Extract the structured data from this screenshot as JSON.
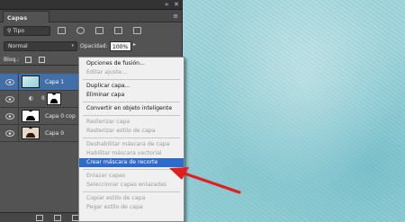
{
  "panel": {
    "tab_label": "Capas",
    "collapse_glyph": "«",
    "close_glyph": "✕",
    "menu_glyph": "≡",
    "filter_kind": "Tipo",
    "blend_mode": "Normal",
    "opacity_label": "Opacidad:",
    "opacity_value": "100%",
    "lock_label": "Bloq.:"
  },
  "layers": [
    {
      "name": "Capa 1",
      "selected": true
    },
    {
      "name": "",
      "selected": false
    },
    {
      "name": "Capa 0 cop",
      "selected": false
    },
    {
      "name": "Capa 0",
      "selected": false
    }
  ],
  "context_menu": {
    "items": [
      {
        "label": "Opciones de fusión...",
        "disabled": false
      },
      {
        "label": "Editar ajuste...",
        "disabled": true
      },
      {
        "sep": true
      },
      {
        "label": "Duplicar capa...",
        "disabled": false
      },
      {
        "label": "Eliminar capa",
        "disabled": false
      },
      {
        "sep": true
      },
      {
        "label": "Convertir en objeto inteligente",
        "disabled": false
      },
      {
        "sep": true
      },
      {
        "label": "Rasterizar capa",
        "disabled": true
      },
      {
        "label": "Rasterizar estilo de capa",
        "disabled": true
      },
      {
        "sep": true
      },
      {
        "label": "Deshabilitar máscara de capa",
        "disabled": true
      },
      {
        "label": "Habilitar máscara vectorial",
        "disabled": true
      },
      {
        "label": "Crear máscara de recorte",
        "disabled": false,
        "highlight": true
      },
      {
        "sep": true
      },
      {
        "label": "Enlazar capas",
        "disabled": true
      },
      {
        "label": "Seleccionar capas enlazadas",
        "disabled": true
      },
      {
        "sep": true
      },
      {
        "label": "Copiar estilo de capa",
        "disabled": true
      },
      {
        "label": "Pegar estilo de capa",
        "disabled": true
      }
    ]
  },
  "colors": {
    "panel_bg": "#535353",
    "selected_layer": "#426fa8",
    "menu_highlight": "#2e6ac9",
    "annotation_arrow": "#e02020",
    "canvas": "#9fd6dc"
  }
}
